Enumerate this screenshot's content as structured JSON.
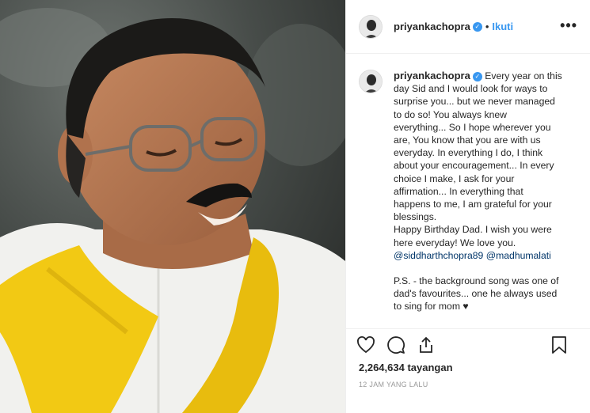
{
  "post": {
    "username": "priyankachopra",
    "follow_label": "Ikuti",
    "more_label": "•••",
    "caption_lines": [
      "Every year on this",
      "day Sid and I would look for ways to",
      "surprise you... but we never managed",
      "to do so! You always knew",
      "everything... So I hope wherever you",
      "are, You know that you are with us",
      "everyday. In everything I do, I think",
      "about your encouragement... In every",
      "choice I make, I ask for your",
      "affirmation... In everything that",
      "happens to me, I am grateful for your",
      "blessings.",
      "Happy Birthday Dad. I wish you were",
      "here everyday! We love you."
    ],
    "mention_1": "@siddharthchopra89",
    "mention_2": "@madhumalati",
    "ps_lines": [
      "P.S. - the background song was one of",
      "dad's favourites... one he always used",
      "to sing for mom ♥"
    ],
    "views": "2,264,634 tayangan",
    "timestamp": "12 JAM YANG LALU"
  },
  "icons": {
    "like": "heart-icon",
    "comment": "comment-icon",
    "share": "share-icon",
    "save": "bookmark-icon",
    "verified": "verified-badge-icon"
  }
}
